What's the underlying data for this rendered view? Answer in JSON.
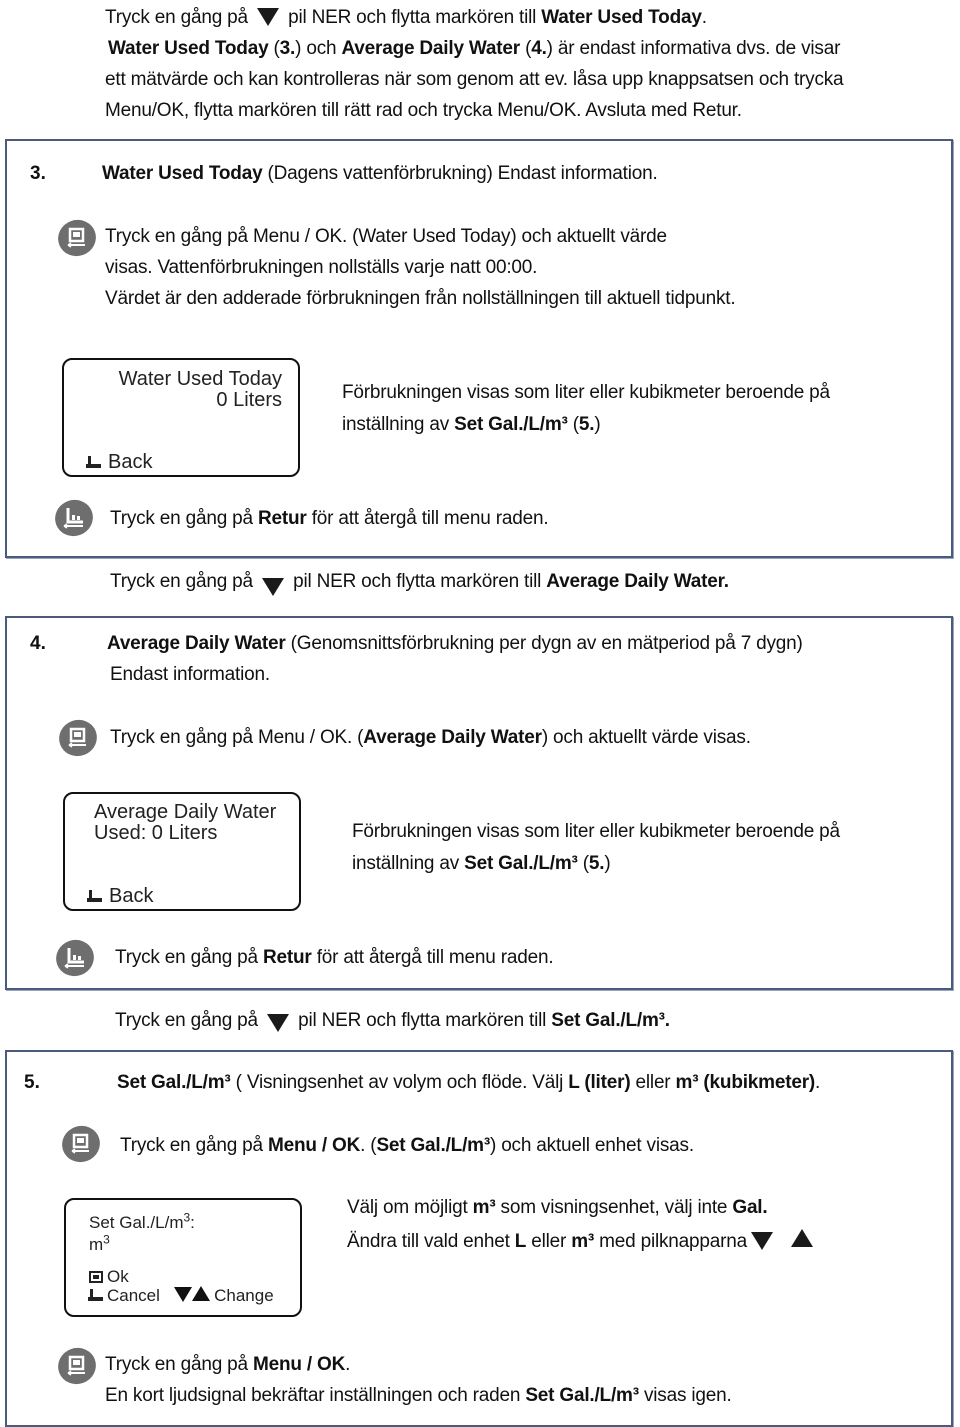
{
  "intro": {
    "line1_a": "Tryck en gång på",
    "line1_b": "pil NER och flytta markören till",
    "line1_bold": "Water Used Today",
    "line1_end": ".",
    "line2_b1": "Water Used Today",
    "line2_t1": " (",
    "line2_b2": "3.",
    "line2_t2": ") och ",
    "line2_b3": "Average Daily Water",
    "line2_t3": " (",
    "line2_b4": "4.",
    "line2_t4": ") är endast informativa dvs. de visar",
    "line3": "ett mätvärde och kan kontrolleras när som genom att ev. låsa upp knappsatsen och trycka",
    "line4": "Menu/OK, flytta markören till rätt rad och trycka Menu/OK. Avsluta med Retur."
  },
  "section3": {
    "number": "3.",
    "title_bold": "Water Used Today",
    "title_rest": " (Dagens vattenförbrukning) Endast information.",
    "menu_line1": "Tryck en gång på Menu / OK. (Water Used Today) och aktuellt värde",
    "menu_line2": "visas. Vattenförbrukningen nollställs varje natt 00:00.",
    "menu_line3": "Värdet är den adderade förbrukningen från nollställningen till aktuell tidpunkt.",
    "lcd": {
      "line1": "Water Used Today",
      "line2": "0 Liters",
      "back": "Back"
    },
    "note_line1": "Förbrukningen visas som liter eller kubikmeter beroende på",
    "note_line2_a": "inställning av ",
    "note_line2_bold": "Set Gal./L/m³",
    "note_line2_c": " (",
    "note_line2_bold2": "5.",
    "note_line2_end": ")",
    "return_a": "Tryck en gång på ",
    "return_bold": "Retur",
    "return_c": " för att återgå till menu raden."
  },
  "nav34": {
    "a": "Tryck en gång på",
    "b": "pil NER och flytta markören till",
    "bold": "Average Daily Water."
  },
  "section4": {
    "number": "4.",
    "title_bold": "Average Daily Water",
    "title_rest": " (Genomsnittsförbrukning per dygn av en mätperiod på 7 dygn)",
    "title_line2": "Endast information.",
    "menu_a": "Tryck en gång på Menu / OK. (",
    "menu_bold": "Average Daily Water",
    "menu_c": ") och aktuellt värde visas.",
    "lcd": {
      "line1": "Average Daily Water",
      "line2": "Used: 0 Liters",
      "back": "Back"
    },
    "note_line1": "Förbrukningen visas som liter eller kubikmeter beroende på",
    "note_line2_a": "inställning av ",
    "note_line2_bold": "Set Gal./L/m³",
    "note_line2_c": " (",
    "note_line2_bold2": "5.",
    "note_line2_end": ")",
    "return_a": "Tryck en gång på ",
    "return_bold": "Retur",
    "return_c": " för att återgå till menu raden."
  },
  "nav45": {
    "a": "Tryck en gång på",
    "b": "pil NER och flytta markören till",
    "bold": "Set Gal./L/m³."
  },
  "section5": {
    "number": "5.",
    "title_bold": "Set Gal./L/m³",
    "title_t1": " ( Visningsenhet av volym och flöde. Välj ",
    "title_b2": "L (liter)",
    "title_t2": " eller ",
    "title_b3": "m³ (kubikmeter)",
    "title_end": ".",
    "menu_a": "Tryck en gång på ",
    "menu_b1": "Menu / OK",
    "menu_t1": ". (",
    "menu_b2": "Set Gal./L/m³",
    "menu_t2": ") och aktuell enhet visas.",
    "lcd": {
      "line1": "Set Gal./L/m",
      "line1_sup": "3",
      "line1_end": ":",
      "line2": "m",
      "line2_sup": "3",
      "ok": "Ok",
      "cancel": "Cancel",
      "change": "Change"
    },
    "note1_a": "Välj om möjligt ",
    "note1_b1": "m³",
    "note1_t1": " som visningsenhet, välj inte ",
    "note1_b2": "Gal.",
    "note2_a": "Ändra till vald enhet ",
    "note2_b1": "L",
    "note2_t1": " eller ",
    "note2_b2": "m³",
    "note2_t2": " med  pilknapparna",
    "confirm1_a": "Tryck en gång på ",
    "confirm1_bold": "Menu / OK",
    "confirm1_end": ".",
    "confirm2_a": "En kort ljudsignal bekräftar inställningen och raden ",
    "confirm2_bold": "Set Gal./L/m³",
    "confirm2_end": " visas igen."
  },
  "colors": {
    "box_border": "#4a5b7c",
    "icon_fill": "#6e6e6e",
    "text": "#111111"
  },
  "icons": {
    "menu_ok": "menu-ok-button-icon",
    "return": "return-button-icon",
    "down": "arrow-down-icon",
    "up": "arrow-up-icon",
    "back": "back-icon"
  }
}
